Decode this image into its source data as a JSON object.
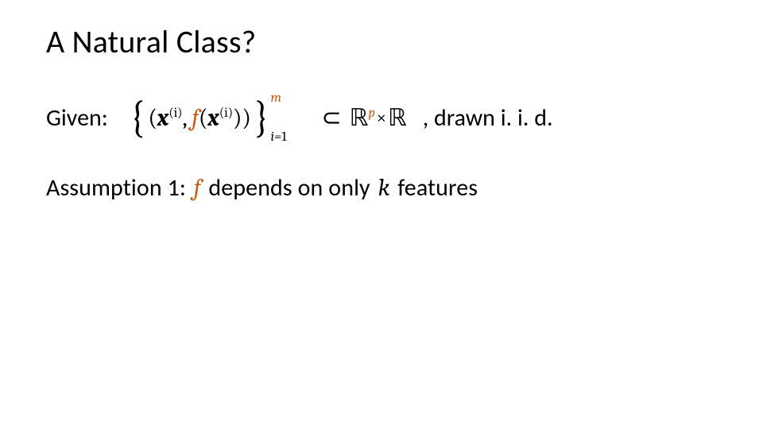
{
  "title": "A Natural Class?",
  "given": {
    "label": "Given:",
    "trail": ", drawn i. i. d."
  },
  "math": {
    "lbrace": "{",
    "rbrace": "}",
    "lparen_outer": "(",
    "rparen_outer": ")",
    "x": "x",
    "sup_i": "(i)",
    "comma": ",",
    "space_comma": ", ",
    "f": "f",
    "lparen": "(",
    "rparen": ")",
    "lim_top": "m",
    "lim_bot_i": "i",
    "lim_bot_eq1": "=1",
    "subset": "⊂",
    "R": "ℝ",
    "p": "p",
    "times": "×"
  },
  "assumption": {
    "prefix": "Assumption 1: ",
    "f": "f",
    "mid": " depends on only ",
    "k": "k",
    "suffix": " features"
  }
}
